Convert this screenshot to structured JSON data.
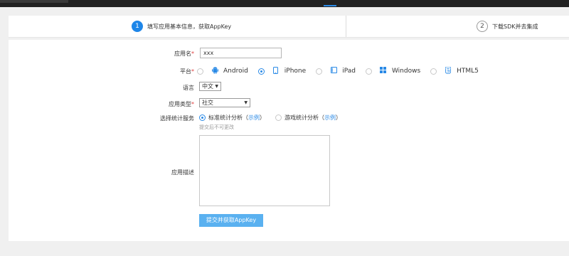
{
  "steps": [
    {
      "number": "1",
      "label": "填写应用基本信息，获取AppKey"
    },
    {
      "number": "2",
      "label": "下载SDK并去集成"
    }
  ],
  "form": {
    "app_name": {
      "label": "应用名",
      "required_mark": "*",
      "value": "xxx"
    },
    "platform": {
      "label": "平台",
      "required_mark": "*",
      "options": [
        {
          "label": "Android",
          "icon": "android-icon",
          "selected": false
        },
        {
          "label": "iPhone",
          "icon": "phone-icon",
          "selected": true
        },
        {
          "label": "iPad",
          "icon": "tablet-icon",
          "selected": false
        },
        {
          "label": "Windows",
          "icon": "windows-icon",
          "selected": false
        },
        {
          "label": "HTML5",
          "icon": "html5-icon",
          "selected": false
        }
      ]
    },
    "language": {
      "label": "语言",
      "value": "中文"
    },
    "app_type": {
      "label": "应用类型",
      "required_mark": "*",
      "value": "社交"
    },
    "stats_service": {
      "label": "选择统计服务",
      "options": [
        {
          "label": "标准统计分析",
          "link_open": "（",
          "link": "示例",
          "link_close": "）",
          "selected": true
        },
        {
          "label": "游戏统计分析",
          "link_open": "（",
          "link": "示例",
          "link_close": "）",
          "selected": false
        }
      ],
      "hint": "提交后不可更改"
    },
    "description": {
      "label": "应用描述",
      "value": ""
    },
    "submit_label": "提交并获取AppKey"
  },
  "colors": {
    "accent": "#1e86e8",
    "button": "#5ab1f0",
    "required": "#e04040",
    "topbar": "#222222"
  }
}
